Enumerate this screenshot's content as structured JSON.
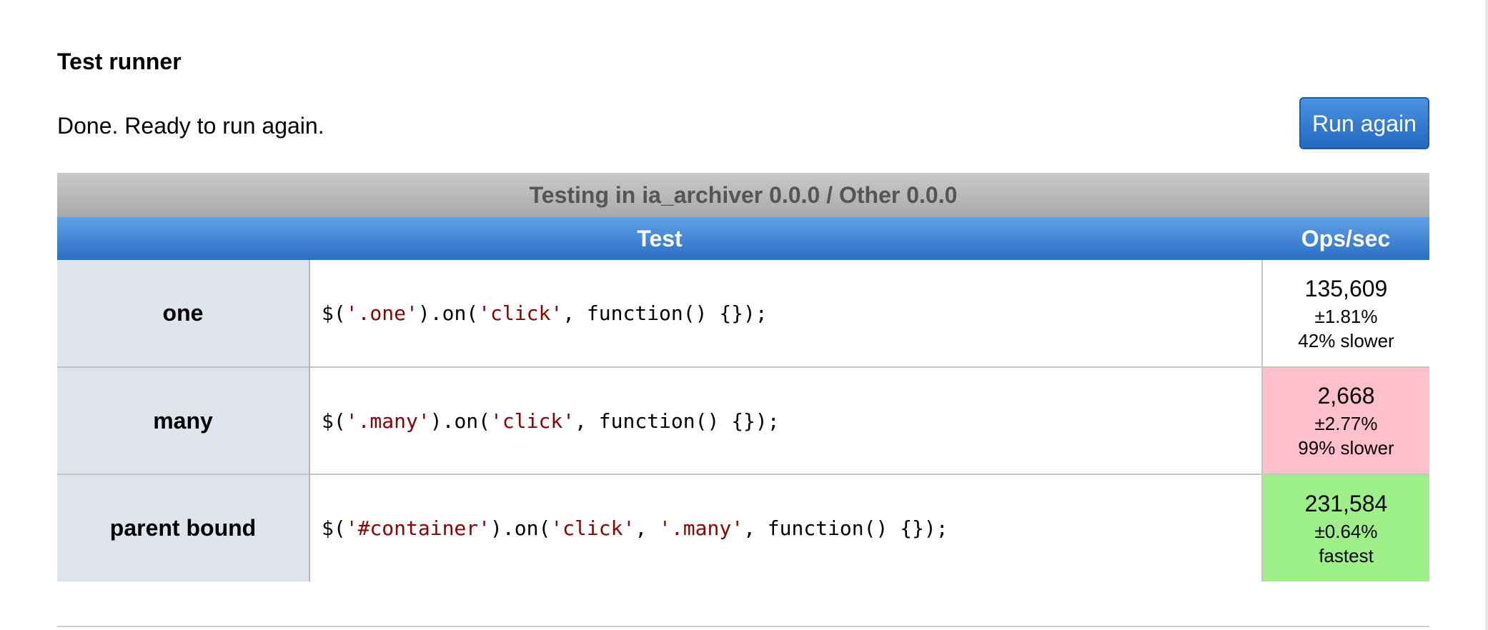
{
  "page": {
    "title": "Test runner",
    "status": "Done. Ready to run again.",
    "run_button_label": "Run again"
  },
  "table": {
    "caption": "Testing in ia_archiver 0.0.0 / Other 0.0.0",
    "headers": {
      "test": "Test",
      "ops": "Ops/sec"
    },
    "rows": [
      {
        "name": "one",
        "code": {
          "p1": "$(",
          "s1": "'.one'",
          "p2": ").on(",
          "s2": "'click'",
          "p3": ", function() {});"
        },
        "ops": "135,609",
        "rme": "±1.81%",
        "note": "42% slower",
        "state": "neutral"
      },
      {
        "name": "many",
        "code": {
          "p1": "$(",
          "s1": "'.many'",
          "p2": ").on(",
          "s2": "'click'",
          "p3": ", function() {});"
        },
        "ops": "2,668",
        "rme": "±2.77%",
        "note": "99% slower",
        "state": "slowest"
      },
      {
        "name": "parent bound",
        "code": {
          "p1": "$(",
          "s1": "'#container'",
          "p2": ").on(",
          "s2": "'click'",
          "p3": ", ",
          "s3": "'.many'",
          "p4": ", function() {});"
        },
        "ops": "231,584",
        "rme": "±0.64%",
        "note": "fastest",
        "state": "fastest"
      }
    ]
  },
  "colors": {
    "slowest": "#ffc0cb",
    "fastest": "#9def87",
    "header_blue": "#2a6fc4",
    "code_string": "#8b0000"
  }
}
